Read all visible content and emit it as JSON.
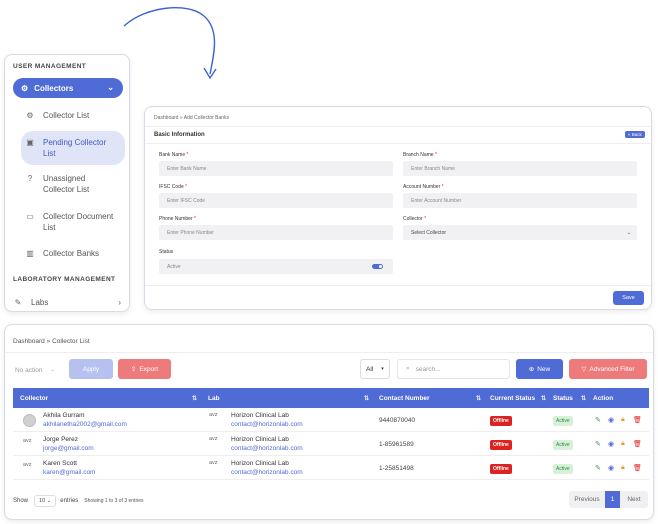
{
  "sidebar": {
    "section1": "USER MANAGEMENT",
    "active_label": "Collectors",
    "items": [
      {
        "label1": "Collector List",
        "label2": ""
      },
      {
        "label1": "Pending Collector",
        "label2": "List"
      },
      {
        "label1": "Unassigned",
        "label2": "Collector List"
      },
      {
        "label1": "Collector Document",
        "label2": "List"
      },
      {
        "label1": "Collector Banks",
        "label2": ""
      }
    ],
    "section2": "LABORATORY MANAGEMENT",
    "labs_label": "Labs"
  },
  "form": {
    "breadcrumb_home": "Dashboard",
    "breadcrumb_sep": "»",
    "breadcrumb_current": "Add Collector Banks",
    "title": "Basic Information",
    "back_label": "« Back",
    "fields": {
      "bank_name": {
        "label": "Bank Name",
        "placeholder": "Enter Bank Name"
      },
      "branch_name": {
        "label": "Branch Name",
        "placeholder": "Enter Branch Name"
      },
      "ifsc_code": {
        "label": "IFSC Code",
        "placeholder": "Enter IFSC Code"
      },
      "account_number": {
        "label": "Account Number",
        "placeholder": "Enter Account Number"
      },
      "phone_number": {
        "label": "Phone Number",
        "placeholder": "Enter Phone Number"
      },
      "collector": {
        "label": "Collector",
        "placeholder": "Select Collector"
      },
      "status": {
        "label": "Status",
        "value": "Active",
        "on": true
      }
    },
    "required_mark": "*",
    "save_label": "Save"
  },
  "list": {
    "breadcrumb_home": "Dashboard",
    "breadcrumb_sep": "»",
    "breadcrumb_current": "Collector List",
    "no_action": "No action",
    "apply": "Apply",
    "export": "Export",
    "filter_all": "All",
    "search_placeholder": "search...",
    "new_label": "New",
    "advanced_filter": "Advanced Filter",
    "headers": [
      "Collector",
      "Lab",
      "Contact Number",
      "Current Status",
      "Status",
      "Action"
    ],
    "rows": [
      {
        "name": "Akhila Gurram",
        "email": "akhilanetha2002@gmail.com",
        "avatar_alt": "",
        "lab_alt": "avz",
        "lab": "Horizon Clinical Lab",
        "lab_email": "contact@horizonlab.com",
        "contact": "9440870040",
        "current": "Offline",
        "status": "Active"
      },
      {
        "name": "Jorge Perez",
        "email": "jorge@gmail.com",
        "avatar_alt": "avz",
        "lab_alt": "avz",
        "lab": "Horizon Clinical Lab",
        "lab_email": "contact@horizonlab.com",
        "contact": "1-85961589",
        "current": "Offline",
        "status": "Active"
      },
      {
        "name": "Karen Scott",
        "email": "karen@gmail.com",
        "avatar_alt": "avz",
        "lab_alt": "avz",
        "lab": "Horizon Clinical Lab",
        "lab_email": "contact@horizonlab.com",
        "contact": "1-25851498",
        "current": "Offline",
        "status": "Active"
      }
    ],
    "show_label": "Show",
    "page_size": "10",
    "entries_label": "entries",
    "showing_text": "Showing 1 to 3 of 3 entries",
    "prev_label": "Previous",
    "current_page": "1",
    "next_label": "Next"
  },
  "colors": {
    "primary": "#4f6bd6",
    "danger": "#ee7b7b",
    "offline": "#dd2222",
    "active_bg": "#d8f0da"
  }
}
